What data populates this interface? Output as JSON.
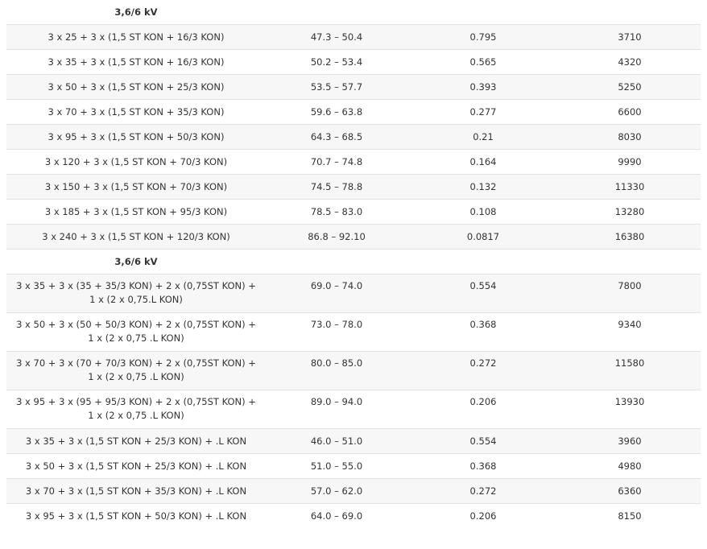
{
  "sections": [
    {
      "heading": "3,6/6 kV",
      "rows": [
        {
          "type": "3 x 25 + 3 x (1,5 ST KON + 16/3 KON)",
          "diameter": "47.3 – 50.4",
          "resistance": "0.795",
          "weight": "3710"
        },
        {
          "type": "3 x 35 + 3 x (1,5 ST KON + 16/3 KON)",
          "diameter": "50.2 – 53.4",
          "resistance": "0.565",
          "weight": "4320"
        },
        {
          "type": "3 x 50 + 3 x (1,5 ST KON + 25/3 KON)",
          "diameter": "53.5 – 57.7",
          "resistance": "0.393",
          "weight": "5250"
        },
        {
          "type": "3 x 70 + 3 x (1,5 ST KON + 35/3 KON)",
          "diameter": "59.6 – 63.8",
          "resistance": "0.277",
          "weight": "6600"
        },
        {
          "type": "3 x 95 + 3 x (1,5 ST KON + 50/3 KON)",
          "diameter": "64.3 – 68.5",
          "resistance": "0.21",
          "weight": "8030"
        },
        {
          "type": "3 x 120 + 3 x (1,5 ST KON + 70/3 KON)",
          "diameter": "70.7 – 74.8",
          "resistance": "0.164",
          "weight": "9990"
        },
        {
          "type": "3 x 150 + 3 x (1,5 ST KON + 70/3 KON)",
          "diameter": "74.5 – 78.8",
          "resistance": "0.132",
          "weight": "11330"
        },
        {
          "type": "3 x 185 + 3 x (1,5 ST KON + 95/3 KON)",
          "diameter": "78.5 – 83.0",
          "resistance": "0.108",
          "weight": "13280"
        },
        {
          "type": "3 x 240 + 3 x (1,5 ST KON + 120/3 KON)",
          "diameter": "86.8 – 92.10",
          "resistance": "0.0817",
          "weight": "16380"
        }
      ]
    },
    {
      "heading": "3,6/6 kV",
      "rows": [
        {
          "type": "3 x 35 + 3 x (35 + 35/3 KON) + 2 x (0,75ST KON) + 1 x (2 x 0,75.L KON)",
          "diameter": "69.0 – 74.0",
          "resistance": "0.554",
          "weight": "7800"
        },
        {
          "type": "3 x 50 + 3 x (50 + 50/3 KON) + 2 x (0,75ST KON) + 1 x (2 x 0,75 .L KON)",
          "diameter": "73.0 – 78.0",
          "resistance": "0.368",
          "weight": "9340"
        },
        {
          "type": "3 x 70 + 3 x (70 + 70/3 KON) + 2 x (0,75ST KON) + 1 x (2 x 0,75 .L KON)",
          "diameter": "80.0 – 85.0",
          "resistance": "0.272",
          "weight": "11580"
        },
        {
          "type": "3 x 95 + 3 x (95 + 95/3 KON) + 2 x (0,75ST KON) + 1 x (2 x 0,75 .L KON)",
          "diameter": "89.0 – 94.0",
          "resistance": "0.206",
          "weight": "13930"
        },
        {
          "type": "3 x 35 + 3 x (1,5 ST KON + 25/3 KON) + .L KON",
          "diameter": "46.0 – 51.0",
          "resistance": "0.554",
          "weight": "3960"
        },
        {
          "type": "3 x 50 + 3 x (1,5 ST KON + 25/3 KON) + .L KON",
          "diameter": "51.0 – 55.0",
          "resistance": "0.368",
          "weight": "4980"
        },
        {
          "type": "3 x 70 + 3 x (1,5 ST KON + 35/3 KON) + .L KON",
          "diameter": "57.0 – 62.0",
          "resistance": "0.272",
          "weight": "6360"
        },
        {
          "type": "3 x 95 + 3 x (1,5 ST KON + 50/3 KON) + .L KON",
          "diameter": "64.0 – 69.0",
          "resistance": "0.206",
          "weight": "8150"
        }
      ]
    }
  ]
}
